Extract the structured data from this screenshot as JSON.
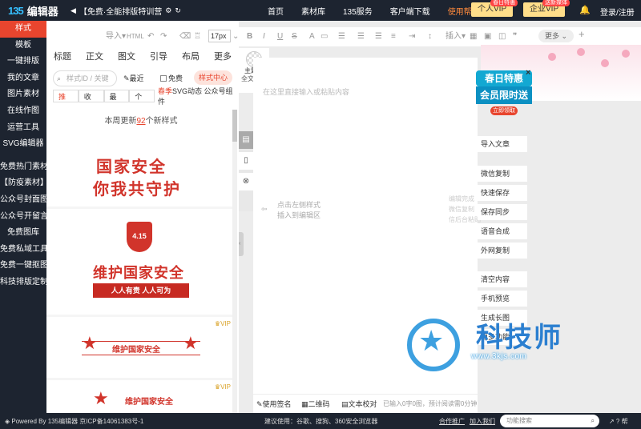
{
  "topbar": {
    "logo_mark": "135",
    "logo_name": "编辑器",
    "promo_text": "【免费·全能排版特训营",
    "nav": [
      "首页",
      "素材库",
      "135服务",
      "客户端下载",
      "使用帮助"
    ],
    "vip_personal": "个人VIP",
    "vip_personal_tag": "春日特惠",
    "vip_enterprise": "企业VIP",
    "vip_enterprise_tag": "送新媒体",
    "login": "登录/注册"
  },
  "leftnav": {
    "items": [
      "样式",
      "模板",
      "一键排版",
      "我的文章",
      "图片素材",
      "在线作图",
      "运营工具",
      "SVG编辑器",
      "免费热门素材",
      "【防疫素材】",
      "公众号封面图",
      "公众号开留言",
      "免费图库",
      "免费私域工具",
      "免费一键抠图",
      "科技排版定制"
    ]
  },
  "panel": {
    "category_tabs": [
      "标题",
      "正文",
      "图文",
      "引导",
      "布局",
      "更多"
    ],
    "search_placeholder": "样式ID / 关键",
    "recent": "最近",
    "free": "免费",
    "style_center": "样式中心",
    "sub_tabs": [
      "推荐",
      "收藏",
      "最新",
      "个人"
    ],
    "svg_tab_prefix": "春季",
    "svg_tab": "SVG动态 公众号组件",
    "weekly_prefix": "本周更新",
    "weekly_count": "92",
    "weekly_suffix": "个新样式",
    "tpl1_line1": "国家安全",
    "tpl1_line2": "你我共守护",
    "tpl2_badge": "4.15",
    "tpl2_title": "维护国家安全",
    "tpl2_banner": "人人有责 人人可为",
    "tpl3_text": "维护国家安全",
    "tpl3_vip": "VIP",
    "tpl4_text": "维护国家安全",
    "tpl4_vip": "VIP"
  },
  "theme": {
    "label": "主题色",
    "sub": "全文黑白"
  },
  "toolbar": {
    "items": [
      "导入",
      "HTML",
      "17px",
      "B",
      "I",
      "U",
      "S",
      "A",
      "插入",
      "更多"
    ]
  },
  "editor": {
    "paste_hint": "在这里直接输入或粘贴内容",
    "click_hint_1": "点击左侧样式",
    "click_hint_2": "插入到编辑区",
    "partial_1": "编辑完成",
    "partial_2": "微信复制",
    "partial_3": "信后台粘贴"
  },
  "bottombar": {
    "signature": "使用签名",
    "qrcode": "二维码",
    "proofread": "文本校对",
    "counter": "已输入0字0图，预计阅读需0分钟"
  },
  "righttools": [
    "导入文章",
    "微信复制",
    "快速保存",
    "保存同步",
    "语音合成",
    "外网复制",
    "清空内容",
    "手机预览",
    "生成长图",
    "更多功能"
  ],
  "promo_card": {
    "line1": "春日特惠",
    "line2": "会员限时送",
    "cta": "立即领取"
  },
  "footer": {
    "powered": "Powered By 135编辑器  京ICP备14061383号-1",
    "browser_tip": "建议使用：谷歌、搜狗、360安全浏览器",
    "coop": "合作推广",
    "join": "加入我们",
    "search_placeholder": "功能搜索",
    "help": "帮"
  },
  "watermark": {
    "text": "科技师",
    "url": "www.3kjs.com"
  }
}
